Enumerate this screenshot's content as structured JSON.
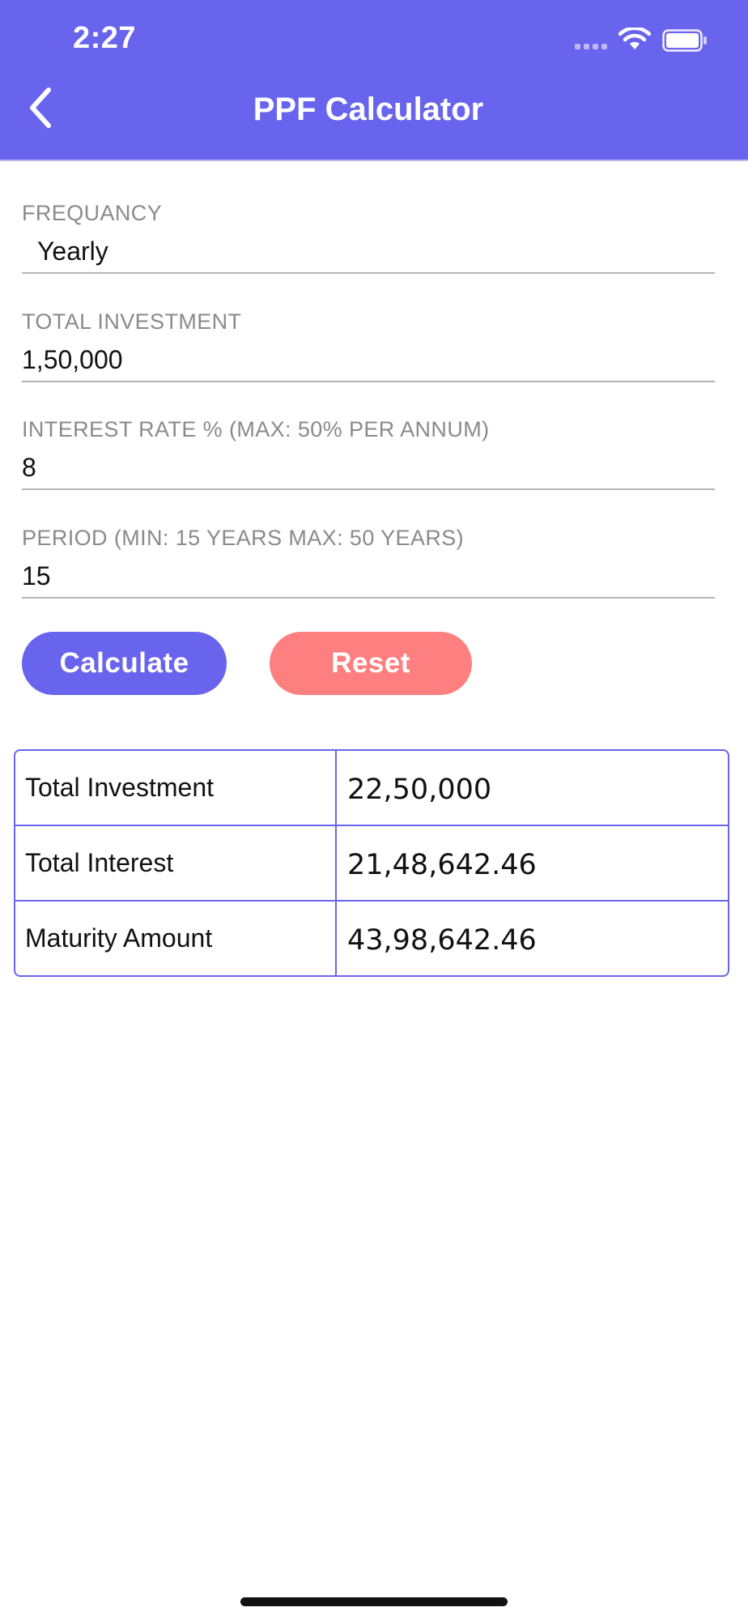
{
  "status_bar": {
    "time": "2:27"
  },
  "header": {
    "title": "PPF Calculator",
    "back_icon": "chevron-left-icon",
    "background_color": "#6864ee"
  },
  "form": {
    "fields": [
      {
        "label": "FREQUANCY",
        "value": "Yearly"
      },
      {
        "label": "TOTAL INVESTMENT",
        "value": "1,50,000"
      },
      {
        "label": "INTEREST RATE % (MAX: 50% PER ANNUM)",
        "value": "8"
      },
      {
        "label": "PERIOD (MIN: 15 YEARS MAX: 50 YEARS)",
        "value": "15"
      }
    ]
  },
  "buttons": {
    "calculate_label": "Calculate",
    "reset_label": "Reset",
    "calculate_color": "#6864ee",
    "reset_color": "#fe7f7f"
  },
  "results": {
    "rows": [
      {
        "label": "Total Investment",
        "value": "22,50,000"
      },
      {
        "label": "Total Interest",
        "value": "21,48,642.46"
      },
      {
        "label": "Maturity Amount",
        "value": "43,98,642.46"
      }
    ]
  }
}
